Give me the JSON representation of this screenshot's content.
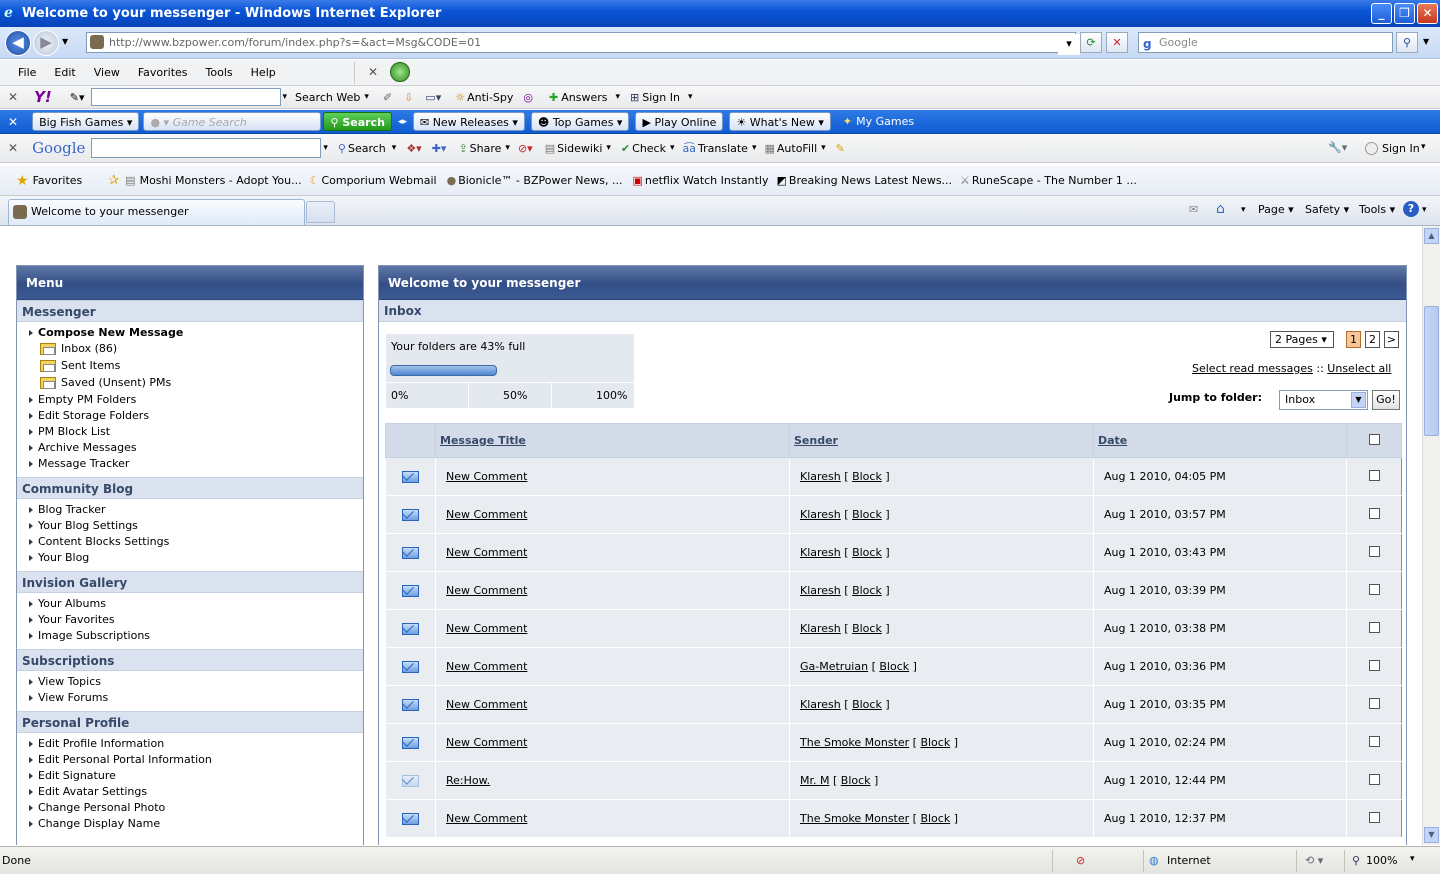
{
  "window": {
    "title": "Welcome to your messenger - Windows Internet Explorer"
  },
  "address": {
    "url": "http://www.bzpower.com/forum/index.php?s=&act=Msg&CODE=01",
    "search_placeholder": "Google"
  },
  "menu": [
    "File",
    "Edit",
    "View",
    "Favorites",
    "Tools",
    "Help"
  ],
  "yahoo_toolbar": {
    "search_web": "Search Web",
    "anti_spy": "Anti-Spy",
    "answers": "Answers",
    "sign_in": "Sign In"
  },
  "bigfish_toolbar": {
    "brand": "Big Fish Games",
    "game_search_placeholder": "Game Search",
    "search": "Search",
    "new_releases": "New Releases",
    "top_games": "Top Games",
    "play_online": "Play Online",
    "whats_new": "What's New",
    "my_games": "My Games"
  },
  "google_toolbar": {
    "brand": "Google",
    "search": "Search",
    "share": "Share",
    "sidewiki": "Sidewiki",
    "check": "Check",
    "translate": "Translate",
    "autofill": "AutoFill",
    "sign_in": "Sign In"
  },
  "favorites_bar": {
    "favorites": "Favorites",
    "links": [
      "Moshi Monsters - Adopt You...",
      "Comporium Webmail",
      "Bionicle™ - BZPower News, ...",
      "netflix Watch Instantly",
      "Breaking News  Latest News...",
      "RuneScape - The Number 1 ..."
    ]
  },
  "tab": {
    "title": "Welcome to your messenger"
  },
  "command_bar": {
    "page": "Page",
    "safety": "Safety",
    "tools": "Tools"
  },
  "sidebar": {
    "title": "Menu",
    "sections": [
      {
        "title": "Messenger",
        "items": [
          "Compose New Message",
          "Inbox (86)",
          "Sent Items",
          "Saved (Unsent) PMs",
          "Empty PM Folders",
          "Edit Storage Folders",
          "PM Block List",
          "Archive Messages",
          "Message Tracker"
        ]
      },
      {
        "title": "Community Blog",
        "items": [
          "Blog Tracker",
          "Your Blog Settings",
          "Content Blocks Settings",
          "Your Blog"
        ]
      },
      {
        "title": "Invision Gallery",
        "items": [
          "Your Albums",
          "Your Favorites",
          "Image Subscriptions"
        ]
      },
      {
        "title": "Subscriptions",
        "items": [
          "View Topics",
          "View Forums"
        ]
      },
      {
        "title": "Personal Profile",
        "items": [
          "Edit Profile Information",
          "Edit Personal Portal Information",
          "Edit Signature",
          "Edit Avatar Settings",
          "Change Personal Photo",
          "Change Display Name"
        ]
      }
    ]
  },
  "main": {
    "title": "Welcome to your messenger",
    "folder": "Inbox",
    "quota_text": "Your folders are 43% full",
    "quota_percent": 43,
    "scale": [
      "0%",
      "50%",
      "100%"
    ],
    "pages_label": "2 Pages",
    "pages": [
      "1",
      "2",
      ">"
    ],
    "select_read": "Select read messages",
    "separator": "::",
    "unselect_all": "Unselect all",
    "jump_label": "Jump to folder:",
    "jump_value": "Inbox",
    "go": "Go!",
    "columns": [
      "Message Title",
      "Sender",
      "Date"
    ],
    "block_label": "Block",
    "rows": [
      {
        "title": "New Comment",
        "sender": "Klaresh",
        "date": "Aug 1 2010, 04:05 PM",
        "read": false
      },
      {
        "title": "New Comment",
        "sender": "Klaresh",
        "date": "Aug 1 2010, 03:57 PM",
        "read": false
      },
      {
        "title": "New Comment",
        "sender": "Klaresh",
        "date": "Aug 1 2010, 03:43 PM",
        "read": false
      },
      {
        "title": "New Comment",
        "sender": "Klaresh",
        "date": "Aug 1 2010, 03:39 PM",
        "read": false
      },
      {
        "title": "New Comment",
        "sender": "Klaresh",
        "date": "Aug 1 2010, 03:38 PM",
        "read": false
      },
      {
        "title": "New Comment",
        "sender": "Ga-Metruian",
        "date": "Aug 1 2010, 03:36 PM",
        "read": false
      },
      {
        "title": "New Comment",
        "sender": "Klaresh",
        "date": "Aug 1 2010, 03:35 PM",
        "read": false
      },
      {
        "title": "New Comment",
        "sender": "The Smoke Monster",
        "date": "Aug 1 2010, 02:24 PM",
        "read": false
      },
      {
        "title": "Re:How.",
        "sender": "Mr. M",
        "date": "Aug 1 2010, 12:44 PM",
        "read": true
      },
      {
        "title": "New Comment",
        "sender": "The Smoke Monster",
        "date": "Aug 1 2010, 12:37 PM",
        "read": false
      }
    ]
  },
  "status": {
    "text": "Done",
    "zone": "Internet",
    "zoom": "100%"
  }
}
